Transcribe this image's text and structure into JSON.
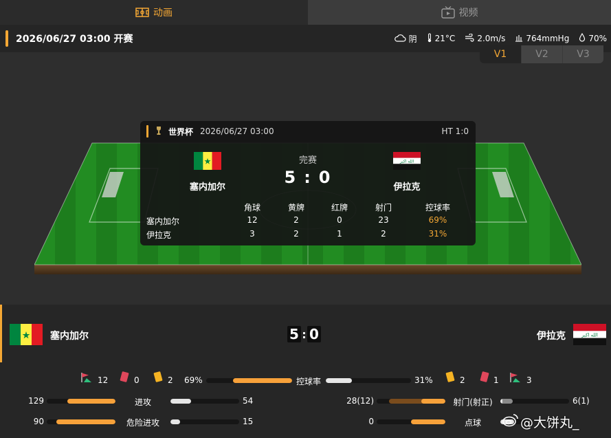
{
  "tabs": [
    {
      "label": "动画",
      "icon": "field-icon",
      "active": true
    },
    {
      "label": "视频",
      "icon": "tv-icon",
      "active": false
    }
  ],
  "info_bar": {
    "datetime": "2026/06/27 03:00 开赛",
    "weather": {
      "condition": "阴",
      "temperature": "21°C",
      "wind": "2.0m/s",
      "pressure": "764mmHg",
      "humidity": "70%"
    }
  },
  "versions": [
    "V1",
    "V2",
    "V3"
  ],
  "active_version": "V1",
  "scorecard": {
    "competition": "世界杯",
    "date": "2026/06/27 03:00",
    "half_time": "HT 1:0",
    "status": "完赛",
    "home_name": "塞内加尔",
    "away_name": "伊拉克",
    "home_score": "5",
    "away_score": "0",
    "headers": [
      "角球",
      "黄牌",
      "红牌",
      "射门",
      "控球率"
    ],
    "rows": [
      {
        "team": "塞内加尔",
        "values": [
          "12",
          "2",
          "0",
          "23",
          "69%"
        ]
      },
      {
        "team": "伊拉克",
        "values": [
          "3",
          "2",
          "1",
          "2",
          "31%"
        ]
      }
    ]
  },
  "board": {
    "home_name": "塞内加尔",
    "away_name": "伊拉克",
    "home_score": "5",
    "away_score": "0",
    "home_counts": {
      "corners": "12",
      "red_cards": "0",
      "yellow_cards": "2"
    },
    "away_counts": {
      "yellow_cards": "2",
      "red_cards": "1",
      "corners": "3"
    },
    "stats": {
      "possession": {
        "label": "控球率",
        "home": "69%",
        "away": "31%",
        "home_value": 69,
        "away_value": 31
      },
      "attacks": {
        "label": "进攻",
        "home": "129",
        "away": "54",
        "home_value": 129,
        "away_value": 54
      },
      "dangerous_attacks": {
        "label": "危险进攻",
        "home": "90",
        "away": "15",
        "home_value": 90,
        "away_value": 15
      },
      "shots": {
        "label": "射门(射正)",
        "home": "28(12)",
        "away": "6(1)",
        "home_value": 28,
        "home_on_target": 12,
        "away_value": 6,
        "away_on_target": 1
      },
      "penalties": {
        "label": "点球",
        "home": "0",
        "away": "0"
      }
    }
  },
  "watermark": "@大饼丸_",
  "colors": {
    "accent": "#f4a734",
    "bar_orange": "#f7a13a",
    "bar_white": "#e6e6e6",
    "pitch_green": "#1f8a1f"
  }
}
